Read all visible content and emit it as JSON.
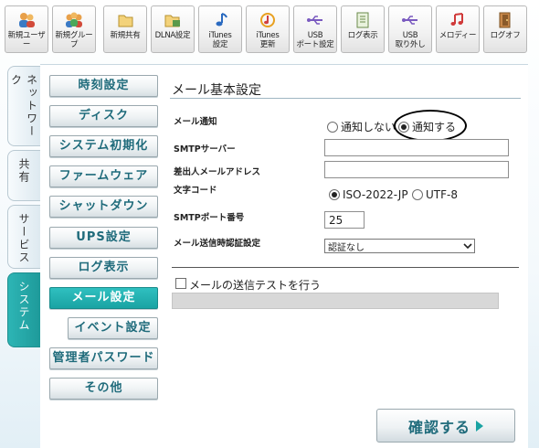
{
  "toolbar": {
    "buttons": [
      {
        "label": "新規ユーザー",
        "icon": "users-icon"
      },
      {
        "label": "新規グループ",
        "icon": "group-icon"
      },
      {
        "label": "新規共有",
        "icon": "folder-icon"
      },
      {
        "label": "DLNA設定",
        "icon": "dlna-folder-icon"
      },
      {
        "label": "iTunes\n設定",
        "icon": "music-note-icon"
      },
      {
        "label": "iTunes\n更新",
        "icon": "itunes-update-icon"
      },
      {
        "label": "USB\nポート設定",
        "icon": "usb-icon"
      },
      {
        "label": "ログ表示",
        "icon": "document-icon"
      },
      {
        "label": "USB\n取り外し",
        "icon": "usb-remove-icon"
      },
      {
        "label": "メロディー",
        "icon": "melody-icon"
      },
      {
        "label": "ログオフ",
        "icon": "logout-door-icon"
      }
    ]
  },
  "tabs": [
    {
      "label": "ネットワーク"
    },
    {
      "label": "共有"
    },
    {
      "label": "サービス"
    },
    {
      "label": "システム"
    }
  ],
  "menu": [
    {
      "label": "時刻設定"
    },
    {
      "label": "ディスク"
    },
    {
      "label": "システム初期化"
    },
    {
      "label": "ファームウェア"
    },
    {
      "label": "シャットダウン"
    },
    {
      "label": "UPS設定"
    },
    {
      "label": "ログ表示"
    },
    {
      "label": "メール設定"
    },
    {
      "label": "イベント設定"
    },
    {
      "label": "管理者パスワード"
    },
    {
      "label": "その他"
    }
  ],
  "form": {
    "title": "メール基本設定",
    "notify_label": "メール通知",
    "notify_off": "通知しない",
    "notify_on": "通知する",
    "notify_selected": "on",
    "smtp_server_label": "SMTPサーバー",
    "smtp_server_value": "",
    "sender_label": "差出人メールアドレス",
    "sender_value": "",
    "charset_label": "文字コード",
    "charset_iso": "ISO-2022-JP",
    "charset_utf": "UTF-8",
    "charset_selected": "iso",
    "port_label": "SMTPポート番号",
    "port_value": "25",
    "auth_label": "メール送信時認証設定",
    "auth_value": "認証なし",
    "test_label": "メールの送信テストを行う",
    "test_checked": false
  },
  "confirm_button": {
    "label": "確認する"
  },
  "colors": {
    "accent": "#1aa3a3",
    "menu_text": "#1f6b7b"
  }
}
